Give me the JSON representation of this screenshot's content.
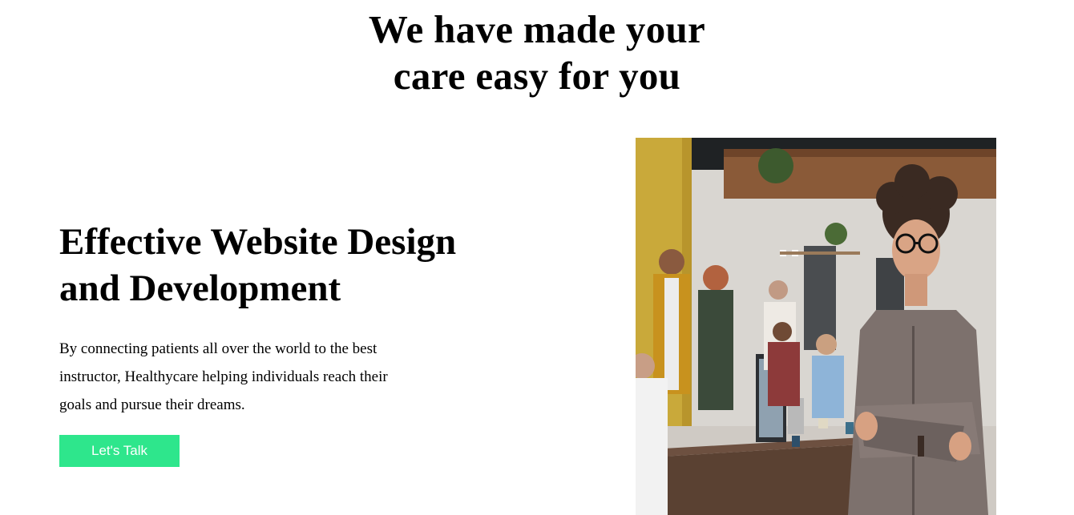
{
  "section": {
    "heading_lines": [
      "We have made your",
      "care easy for you"
    ]
  },
  "feature": {
    "title_lines": [
      "Effective Website Design",
      "and Development"
    ],
    "description_lines": [
      "By connecting patients all over the world to the best",
      "instructor, Healthycare helping individuals reach their",
      "goals and pursue their dreams."
    ],
    "cta_label": "Let's Talk"
  },
  "colors": {
    "cta_background": "#2ee68c",
    "cta_text": "#ffffff",
    "page_background": "#ffffff",
    "text": "#000000"
  }
}
